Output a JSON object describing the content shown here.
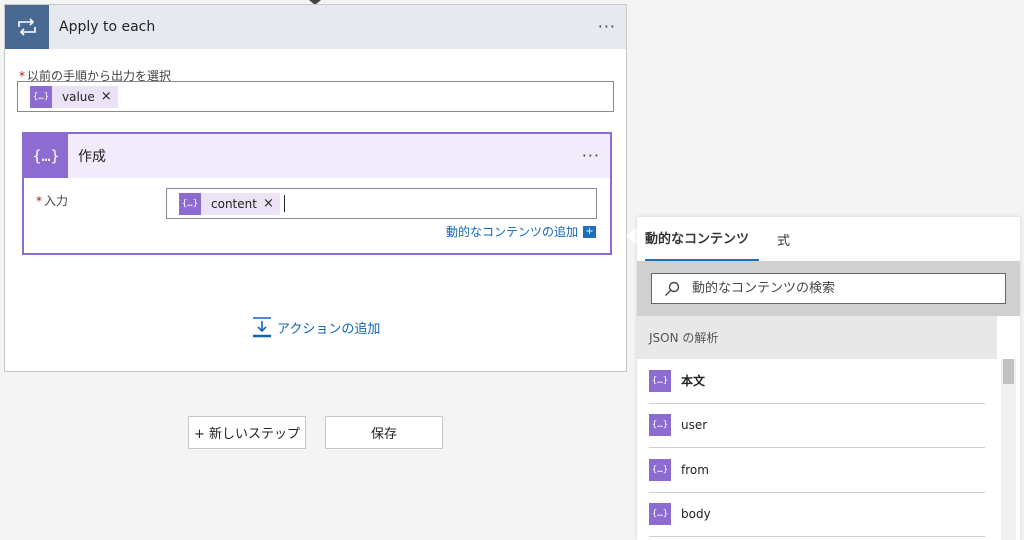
{
  "loop": {
    "title": "Apply to each",
    "more": "···",
    "field_label": "以前の手順から出力を選択",
    "required_mark": "*",
    "token": {
      "label": "value",
      "icon": "{…}",
      "remove": "×"
    }
  },
  "compose": {
    "title": "作成",
    "icon": "{…}",
    "more": "···",
    "input_label": "入力",
    "required_mark": "*",
    "token": {
      "label": "content",
      "icon": "{…}",
      "remove": "×"
    },
    "dynamic_link": "動的なコンテンツの追加",
    "dynamic_link_icon": "+"
  },
  "add_action": "アクションの追加",
  "buttons": {
    "new_step": "+ 新しいステップ",
    "save": "保存"
  },
  "panel": {
    "tabs": [
      {
        "label": "動的なコンテンツ",
        "active": true
      },
      {
        "label": "式",
        "active": false
      }
    ],
    "search_placeholder": "動的なコンテンツの検索",
    "section": "JSON の解析",
    "items": [
      {
        "label": "本文",
        "icon": "{…}"
      },
      {
        "label": "user",
        "icon": "{…}"
      },
      {
        "label": "from",
        "icon": "{…}"
      },
      {
        "label": "body",
        "icon": "{…}"
      }
    ]
  },
  "colors": {
    "loop_accent": "#486991",
    "compose_accent": "#8c6cd0",
    "link": "#0f65b8"
  }
}
